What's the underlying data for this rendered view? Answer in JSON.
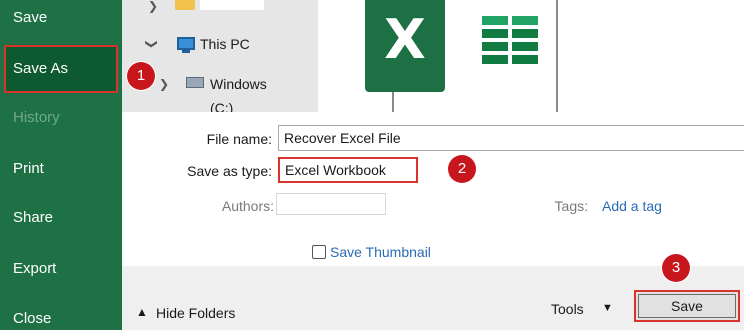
{
  "sidebar": {
    "items": [
      {
        "label": "Save",
        "state": "normal"
      },
      {
        "label": "Save As",
        "state": "selected"
      },
      {
        "label": "History",
        "state": "disabled"
      },
      {
        "label": "Print",
        "state": "normal"
      },
      {
        "label": "Share",
        "state": "normal"
      },
      {
        "label": "Export",
        "state": "normal"
      },
      {
        "label": "Close",
        "state": "normal"
      }
    ]
  },
  "nav_tree": {
    "this_pc_label": "This PC",
    "windows_drive_label": "Windows (C:)"
  },
  "preview": {
    "app_logo_letter": "X"
  },
  "form": {
    "file_name_label": "File name:",
    "file_name_value": "Recover Excel File",
    "save_type_label": "Save as type:",
    "save_type_value": "Excel Workbook",
    "authors_label": "Authors:",
    "authors_value": "",
    "tags_label": "Tags:",
    "tags_link": "Add a tag",
    "thumbnail_label": "Save Thumbnail",
    "thumbnail_checked": false
  },
  "bottom_bar": {
    "hide_folders_label": "Hide Folders",
    "tools_label": "Tools",
    "save_label": "Save"
  },
  "badges": [
    "1",
    "2",
    "3"
  ],
  "colors": {
    "sidebar_bg": "#1e7145",
    "highlight_border": "#d9342b",
    "badge_bg": "#c8171c",
    "link": "#2b6bb5"
  }
}
